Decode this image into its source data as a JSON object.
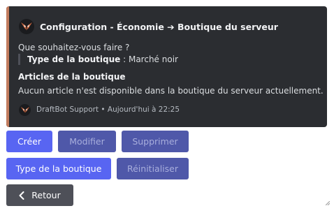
{
  "embed": {
    "accent_color": "#c27c5e",
    "author": {
      "icon": "draftbot-logo-icon",
      "title": "Configuration - Économie ➔ Boutique du serveur"
    },
    "description": "Que souhaitez-vous faire ?",
    "quote": {
      "label": "Type de la boutique",
      "separator": " : ",
      "value": "Marché noir"
    },
    "field": {
      "name": "Articles de la boutique",
      "value": "Aucun article n'est disponible dans la boutique du serveur actuellement."
    },
    "footer": {
      "icon": "draftbot-logo-icon",
      "text": "DraftBot Support • Aujourd'hui à 22:25"
    }
  },
  "buttons": {
    "create": "Créer",
    "modify": "Modifier",
    "delete": "Supprimer",
    "shop_type": "Type de la boutique",
    "reset": "Réinitialiser",
    "back": "Retour",
    "back_icon": "chevron-left-icon"
  },
  "colors": {
    "primary": "#5865f2",
    "primary_disabled": "#4f58a9",
    "secondary": "#4e5058",
    "embed_background": "#2b2d31"
  }
}
